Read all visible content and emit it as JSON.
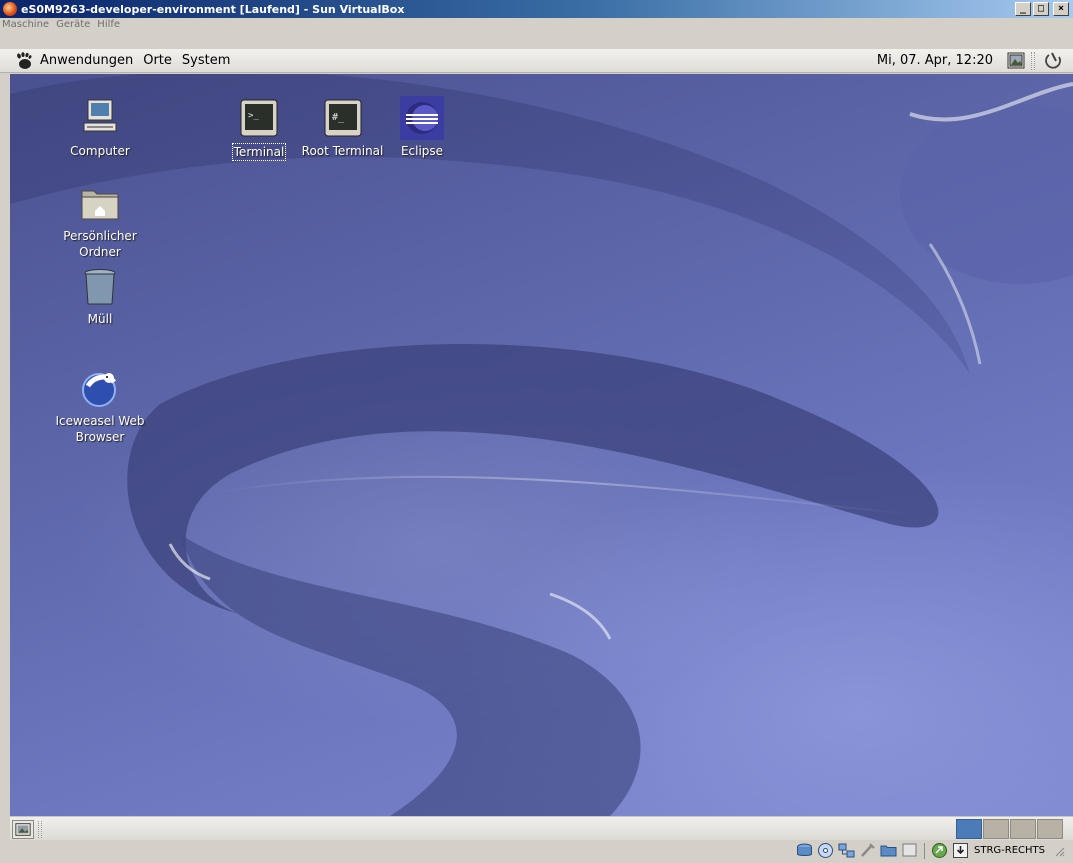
{
  "vbox": {
    "title": "eS0M9263-developer-environment [Laufend] - Sun VirtualBox",
    "window_buttons": {
      "minimize": "_",
      "maximize": "□",
      "close": "×"
    },
    "menus": [
      "Maschine",
      "Geräte",
      "Hilfe"
    ],
    "host_key_label": "STRG-RECHTS"
  },
  "panel": {
    "menus": [
      "Anwendungen",
      "Orte",
      "System"
    ],
    "clock": "Mi, 07. Apr, 12:20"
  },
  "desktop": {
    "icons": [
      {
        "label": "Computer"
      },
      {
        "label": "Persönlicher Ordner"
      },
      {
        "label": "Müll"
      },
      {
        "label": "Iceweasel Web Browser"
      },
      {
        "label": "Terminal"
      },
      {
        "label": "Root Terminal"
      },
      {
        "label": "Eclipse"
      }
    ]
  },
  "workspaces": {
    "count": 4,
    "active": 1
  },
  "icons": {
    "logo": "virtualbox-logo-icon",
    "panel": [
      "gnome-foot-icon",
      "screenshot-icon",
      "shutdown-icon"
    ],
    "status": [
      "hard-disk-icon",
      "cd-rom-icon",
      "network-icon",
      "usb-icon",
      "shared-folders-icon",
      "display-icon",
      "mouse-integration-icon",
      "keyboard-capture-icon"
    ]
  },
  "colors": {
    "title_gradient_start": "#0a246a",
    "title_gradient_end": "#a6caf0",
    "desktop_base": "#5d67aa",
    "active_workspace": "#4b7bb8"
  }
}
